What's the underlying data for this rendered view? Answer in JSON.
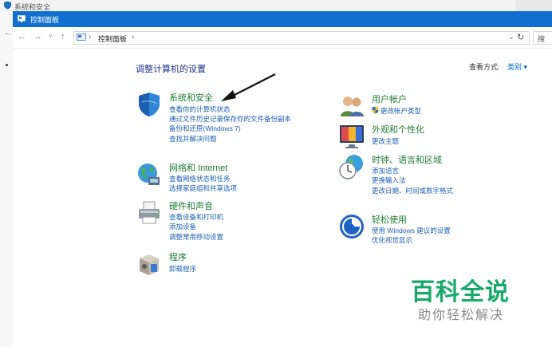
{
  "background_window": {
    "title": "系统和安全"
  },
  "window": {
    "title": "控制面板"
  },
  "address_bar": {
    "back": "←",
    "forward": "→",
    "recent": "˅",
    "up": "↑",
    "separator": "›",
    "crumb": "控制面板",
    "dropdown": "⌄",
    "refresh": "↻",
    "search_placeholder": "搜"
  },
  "page": {
    "heading": "调整计算机的设置",
    "view_by_label": "查看方式:",
    "view_by_value": "类别 ▾"
  },
  "categories": {
    "security": {
      "title": "系统和安全",
      "links": [
        "查看你的计算机状态",
        "通过文件历史记录保存你的文件备份副本",
        "备份和还原(Windows 7)",
        "查找并解决问题"
      ]
    },
    "network": {
      "title": "网络和 Internet",
      "links": [
        "查看网络状态和任务",
        "选择家庭组和共享选项"
      ]
    },
    "hardware": {
      "title": "硬件和声音",
      "links": [
        "查看设备和打印机",
        "添加设备",
        "调整常用移动设置"
      ]
    },
    "programs": {
      "title": "程序",
      "links": [
        "卸载程序"
      ]
    },
    "users": {
      "title": "用户帐户",
      "links": [
        "更改帐户类型"
      ]
    },
    "appearance": {
      "title": "外观和个性化",
      "links": [
        "更改主题"
      ]
    },
    "clock": {
      "title": "时钟、语言和区域",
      "links": [
        "添加语言",
        "更换输入法",
        "更改日期、时间或数字格式"
      ]
    },
    "ease": {
      "title": "轻松使用",
      "links": [
        "使用 Windows 建议的设置",
        "优化视觉显示"
      ]
    }
  },
  "watermark": {
    "brand": "百科全说",
    "slogan": "助你轻松解决"
  },
  "colors": {
    "titlebar": "#1170cf",
    "category_title": "#1b7d2f",
    "link": "#1a5fb4",
    "heading": "#1e3287",
    "watermark": "#17a86a"
  }
}
